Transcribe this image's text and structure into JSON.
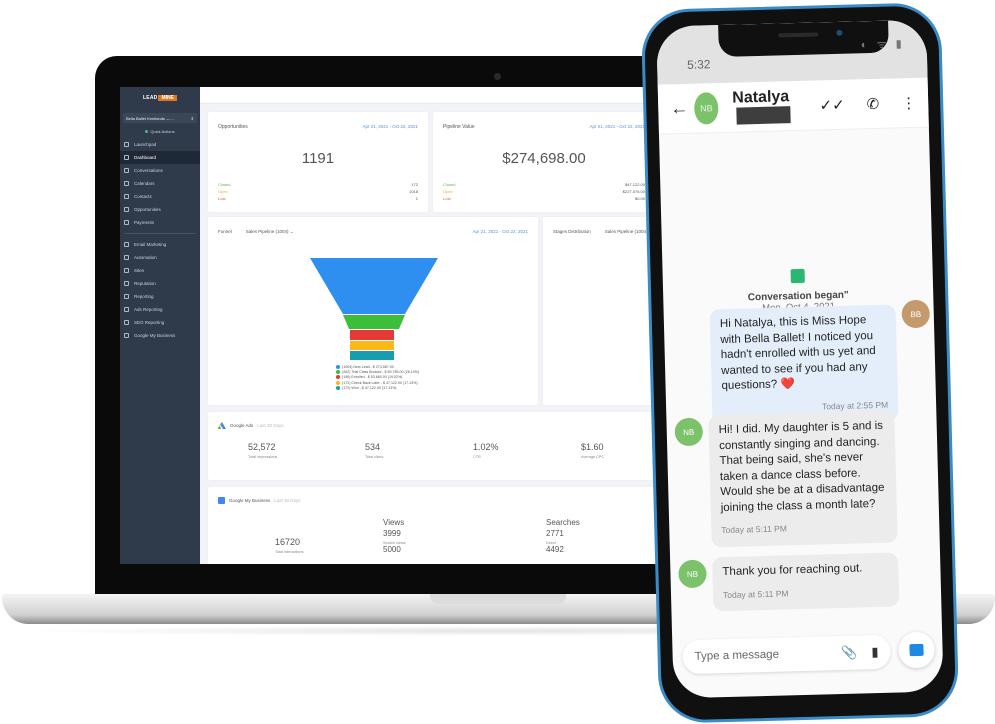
{
  "dashboard": {
    "logo": {
      "left": "LEAD",
      "right": "MINE"
    },
    "account": "Bella Ballet Kentlands — ...",
    "quick_actions": "Quick Actions",
    "nav": [
      {
        "label": "Launchpad",
        "active": false
      },
      {
        "label": "Dashboard",
        "active": true
      },
      {
        "label": "Conversations",
        "active": false
      },
      {
        "label": "Calendars",
        "active": false
      },
      {
        "label": "Contacts",
        "active": false
      },
      {
        "label": "Opportunities",
        "active": false
      },
      {
        "label": "Payments",
        "active": false
      }
    ],
    "nav2": [
      {
        "label": "Email Marketing"
      },
      {
        "label": "Automation"
      },
      {
        "label": "Sites"
      },
      {
        "label": "Reputation"
      },
      {
        "label": "Reporting"
      },
      {
        "label": "Ads Reporting"
      },
      {
        "label": "SEO Reporting"
      },
      {
        "label": "Google My Business"
      }
    ],
    "opportunities": {
      "title": "Opportunities",
      "date": "Apr 21, 2021 - Oct 22, 2021",
      "total": "1191",
      "rows": [
        {
          "label": "Closed",
          "value": "172"
        },
        {
          "label": "Open",
          "value": "1018"
        },
        {
          "label": "Lost",
          "value": "1"
        }
      ]
    },
    "pipeline": {
      "title": "Pipeline Value",
      "date": "Apr 21, 2021 - Oct 22, 2021",
      "total": "$274,698.00",
      "rows": [
        {
          "label": "Closed",
          "value": "$47,122.00"
        },
        {
          "label": "Open",
          "value": "$227,576.00"
        },
        {
          "label": "Lost",
          "value": "$0.00"
        }
      ]
    },
    "funnel": {
      "title": "Funnel",
      "pipeline": "Sales Pipeline (1004)",
      "date": "Apr 21, 2021 - Oct 22, 2021",
      "stages": [
        {
          "label": "(1004) New Lead - $ 274,587.00",
          "color": "#2f8ff0"
        },
        {
          "label": "(262) Trial Class Booked - $ 59,785.00 (26.10%)",
          "color": "#3bbf3b"
        },
        {
          "label": "(196) Enrolled - $ 53,660.00 (19.52%)",
          "color": "#e53935"
        },
        {
          "label": "(172) Check Back Later - $ 47,122.00 (17.13%)",
          "color": "#fbb917"
        },
        {
          "label": "(172) Won - $ 47,122.00 (17.13%)",
          "color": "#1a9cb0"
        }
      ]
    },
    "stages": {
      "title": "Stages Distribution",
      "pipeline": "Sales Pipeline (1004)"
    },
    "google_ads": {
      "title": "Google Ads",
      "sub": "Last 30 Days",
      "metrics": [
        {
          "value": "52,572",
          "label": "Total impressions"
        },
        {
          "value": "534",
          "label": "Total clicks"
        },
        {
          "value": "1.02%",
          "label": "CTR"
        },
        {
          "value": "$1.60",
          "label": "Average CPC"
        }
      ]
    },
    "gmb": {
      "title": "Google My Business",
      "sub": "Last 30 Days",
      "interactions": {
        "value": "16720",
        "label": "Total interactions"
      },
      "views": {
        "heading": "Views",
        "value": "3999",
        "label": "Search views",
        "value2": "5000"
      },
      "searches": {
        "heading": "Searches",
        "value": "2771",
        "label": "Direct",
        "value2": "4492"
      }
    }
  },
  "phone": {
    "time": "5:32",
    "status_icons": "◐ ᯤ ▮",
    "contact": {
      "initials": "NB",
      "name": "Natalya"
    },
    "conversation_began": "Conversation began\"",
    "conversation_date": "Mon, Oct 4, 2021",
    "messages": [
      {
        "from": "BB",
        "text": "Hi Natalya, this is Miss Hope with Bella Ballet! I noticed you hadn't enrolled with us yet and wanted to see if you had any questions? ❤️",
        "time": "Today at 2:55 PM"
      },
      {
        "from": "NB",
        "text": "Hi! I did. My daughter is 5 and is constantly singing and dancing. That being said, she's never taken a dance class before.  Would she be at a disadvantage joining the class a month late?",
        "time": "Today at 5:11 PM"
      },
      {
        "from": "NB",
        "text": "Thank you for reaching out.",
        "time": "Today at 5:11 PM"
      }
    ],
    "composer_placeholder": "Type a message"
  }
}
